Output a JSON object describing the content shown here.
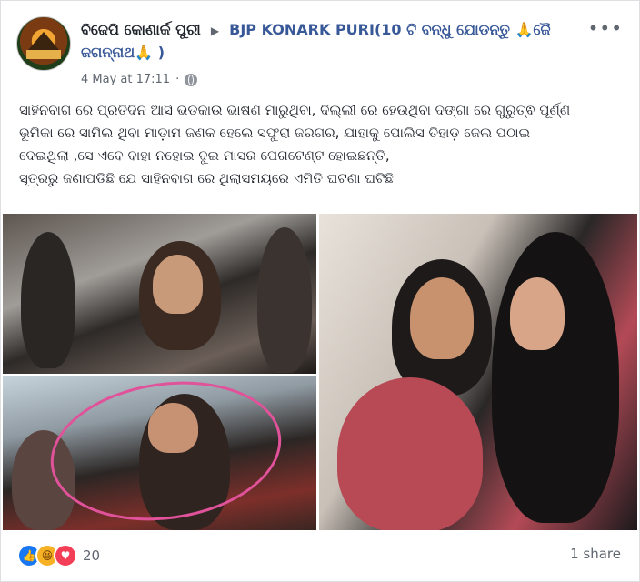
{
  "post": {
    "author": "ବିଜେପି କୋଣାର୍କ ପୁରୀ",
    "group": "BJP KONARK PURI(10 ଟି ବନ୍ଧୁ ଯୋଡନ୍ତୁ 🙏ଜୈ ଜଗନ୍ନାଥ🙏 )",
    "timestamp": "4 May at 17:11",
    "dot": "·",
    "more_icon": "more-options-icon",
    "text_lines": [
      "ସାହିନବାଗ ରେ ପ୍ରତିଦିନ ଆସି ଭଡକାଉ ଭାଷଣ ମାରୁଥିବା, ଦିଲ୍ଲୀ ରେ ହେଉଥିବା ଦଙ୍ଗା ରେ ଗୁରୁତ୍ଵ ପୂର୍ଣ୍ଣ",
      "ଭୂମିକା ରେ ସାମିଲ ଥିବା ମାଡ଼ାମ ଜଣକ ହେଲେ ସଫୁରା ଜରଗର, ଯାହାକୁ ପୋଲିସ ତିହାଡ଼ ଜେଲ ପଠାଇ",
      "ଦେଇଥିଲା ,ସେ ଏବେ ବାହା ନହୋଇ ଦୁଇ ମାସର ପେଗଟେଣ୍ଟ ହୋଇଛନ୍ତି,",
      "ସୂତ୍ରରୁ ଜଣାପଡିଛି ଯେ ସାହିନବାଗ ରେ ଥିଲାସମୟରେ ଏମିତି ଘଟଣା ଘଟିଛି"
    ]
  },
  "footer": {
    "reaction_count": "20",
    "share_text": "1 share",
    "reaction_icons": [
      "like-icon",
      "haha-icon",
      "love-icon"
    ]
  }
}
